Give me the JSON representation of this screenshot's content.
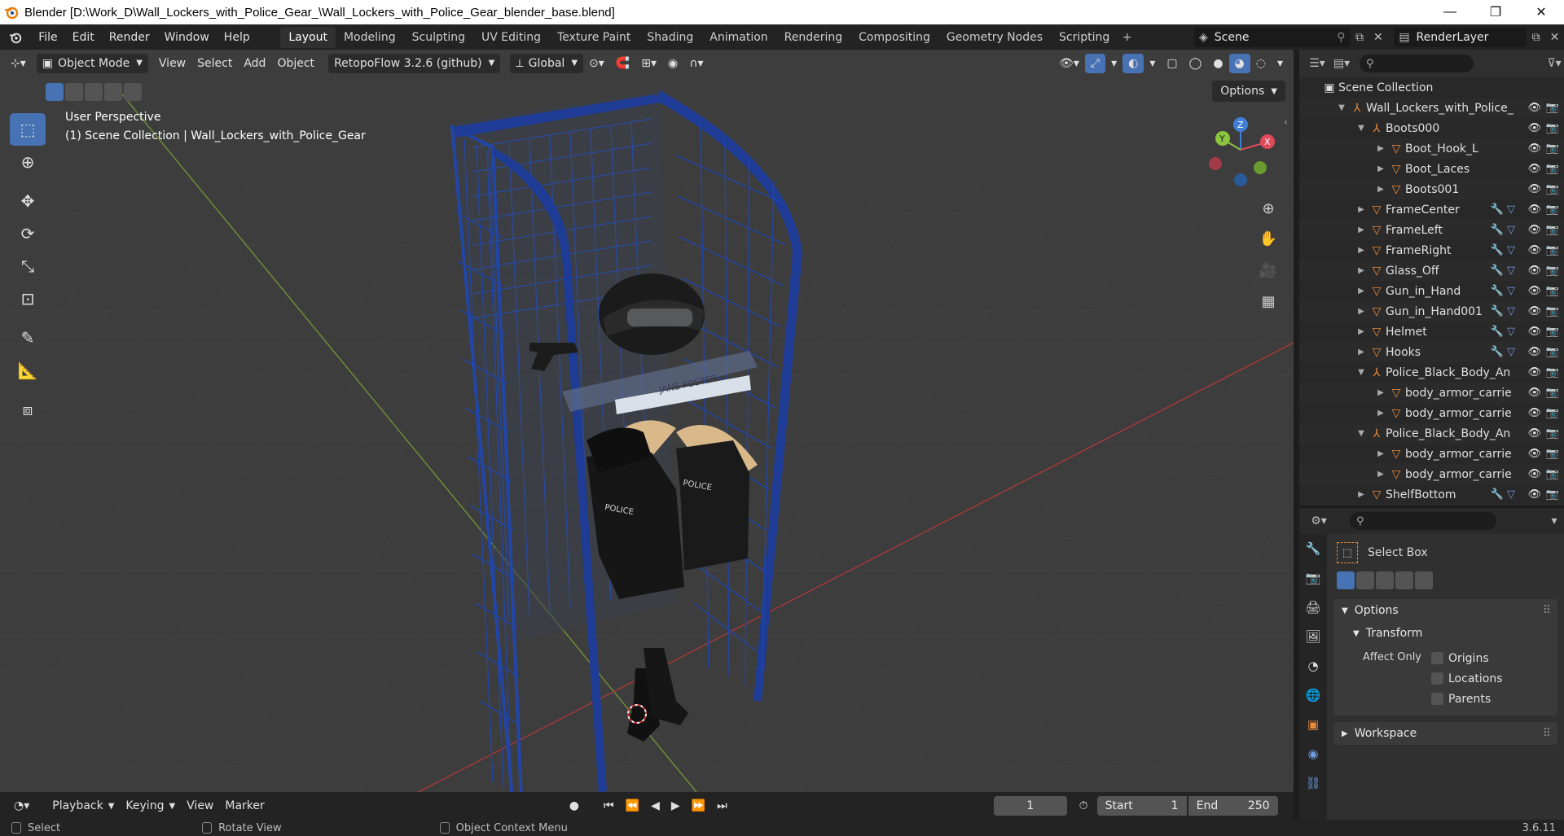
{
  "window": {
    "title": "Blender [D:\\Work_D\\Wall_Lockers_with_Police_Gear_\\Wall_Lockers_with_Police_Gear_blender_base.blend]",
    "minimize": "—",
    "maximize": "❐",
    "close": "✕"
  },
  "menus": [
    "File",
    "Edit",
    "Render",
    "Window",
    "Help"
  ],
  "workspaces": [
    "Layout",
    "Modeling",
    "Sculpting",
    "UV Editing",
    "Texture Paint",
    "Shading",
    "Animation",
    "Rendering",
    "Compositing",
    "Geometry Nodes",
    "Scripting"
  ],
  "active_workspace": "Layout",
  "scene": "Scene",
  "view_layer": "RenderLayer",
  "viewport_header": {
    "mode": "Object Mode",
    "view": "View",
    "select": "Select",
    "add": "Add",
    "object": "Object",
    "addon": "RetopoFlow 3.2.6 (github)",
    "orientation": "Global"
  },
  "viewport": {
    "perspective": "User Perspective",
    "collection_info": "(1) Scene Collection | Wall_Lockers_with_Police_Gear",
    "options": "Options",
    "nameplate": "JANE FOSTER",
    "vest_label": "POLICE"
  },
  "gizmo": {
    "x": "X",
    "y": "Y",
    "z": "Z"
  },
  "outliner": {
    "root": "Scene Collection",
    "rows": [
      {
        "name": "Wall_Lockers_with_Police_",
        "indent": 0,
        "type": "empty",
        "expanded": true
      },
      {
        "name": "Boots000",
        "indent": 1,
        "type": "empty",
        "expanded": true
      },
      {
        "name": "Boot_Hook_L",
        "indent": 2,
        "type": "mesh",
        "expanded": false
      },
      {
        "name": "Boot_Laces",
        "indent": 2,
        "type": "mesh",
        "expanded": false
      },
      {
        "name": "Boots001",
        "indent": 2,
        "type": "mesh",
        "expanded": false
      },
      {
        "name": "FrameCenter",
        "indent": 1,
        "type": "mesh",
        "expanded": false
      },
      {
        "name": "FrameLeft",
        "indent": 1,
        "type": "mesh",
        "expanded": false
      },
      {
        "name": "FrameRight",
        "indent": 1,
        "type": "mesh",
        "expanded": false
      },
      {
        "name": "Glass_Off",
        "indent": 1,
        "type": "mesh",
        "expanded": false
      },
      {
        "name": "Gun_in_Hand",
        "indent": 1,
        "type": "mesh",
        "expanded": false
      },
      {
        "name": "Gun_in_Hand001",
        "indent": 1,
        "type": "mesh",
        "expanded": false
      },
      {
        "name": "Helmet",
        "indent": 1,
        "type": "mesh",
        "expanded": false
      },
      {
        "name": "Hooks",
        "indent": 1,
        "type": "mesh",
        "expanded": false
      },
      {
        "name": "Police_Black_Body_An",
        "indent": 1,
        "type": "empty",
        "expanded": true
      },
      {
        "name": "body_armor_carrie",
        "indent": 2,
        "type": "mesh",
        "expanded": false
      },
      {
        "name": "body_armor_carrie",
        "indent": 2,
        "type": "mesh",
        "expanded": false
      },
      {
        "name": "Police_Black_Body_An",
        "indent": 1,
        "type": "empty",
        "expanded": true
      },
      {
        "name": "body_armor_carrie",
        "indent": 2,
        "type": "mesh",
        "expanded": false
      },
      {
        "name": "body_armor_carrie",
        "indent": 2,
        "type": "mesh",
        "expanded": false
      },
      {
        "name": "ShelfBottom",
        "indent": 1,
        "type": "mesh",
        "expanded": false
      }
    ]
  },
  "properties": {
    "tool_name": "Select Box",
    "options": "Options",
    "transform": "Transform",
    "affect_only": "Affect Only",
    "origins": "Origins",
    "locations": "Locations",
    "parents": "Parents",
    "workspace": "Workspace"
  },
  "timeline": {
    "playback": "Playback",
    "keying": "Keying",
    "view": "View",
    "marker": "Marker",
    "current_frame": "1",
    "start_label": "Start",
    "start": "1",
    "end_label": "End",
    "end": "250"
  },
  "statusbar": {
    "select": "Select",
    "rotate": "Rotate View",
    "context": "Object Context Menu",
    "version": "3.6.11"
  },
  "colors": {
    "accent": "#4772b3",
    "locker_blue": "#1f3f8f",
    "mesh_orange": "#e98a3b",
    "x_axis": "#e04a5a",
    "y_axis": "#8cc63f",
    "z_axis": "#3f7fd6"
  }
}
